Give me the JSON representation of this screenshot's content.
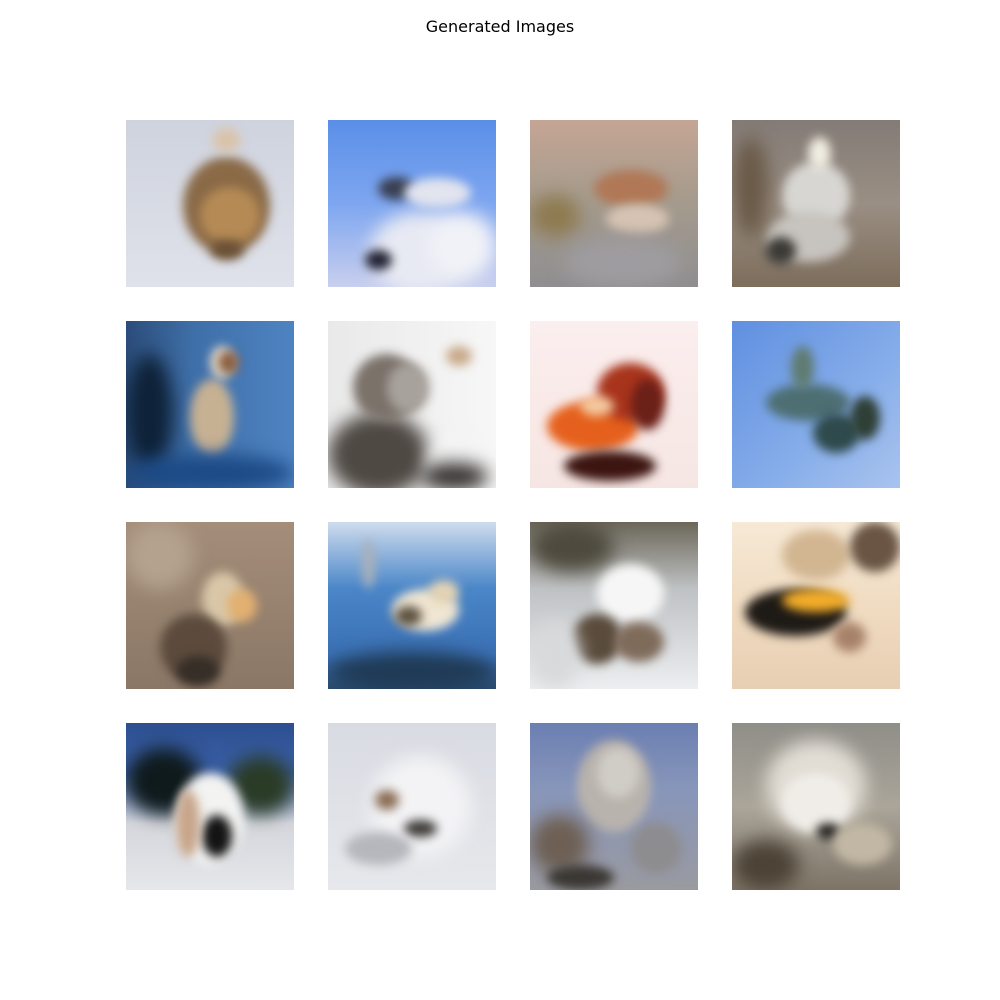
{
  "figure": {
    "title": "Generated Images"
  },
  "images": [
    {
      "bg": "linear-gradient(180deg,#cfd3de 0%,#dfe2ea 100%)",
      "blobs": [
        [
          "#8a6a47",
          34,
          22,
          52,
          58,
          1
        ],
        [
          "#b58a55",
          44,
          40,
          36,
          34,
          1
        ],
        [
          "#d9c3a8",
          52,
          5,
          16,
          14,
          1
        ],
        [
          "#6b5035",
          50,
          72,
          20,
          12,
          1
        ]
      ]
    },
    {
      "bg": "linear-gradient(180deg,#5a8fe8 0%,#7ea6f0 50%,#c9cfee 100%)",
      "blobs": [
        [
          "#e8eaf3",
          25,
          55,
          60,
          50,
          0
        ],
        [
          "#3a3f52",
          30,
          34,
          22,
          14,
          1
        ],
        [
          "#e2e4ee",
          45,
          35,
          40,
          18,
          1
        ],
        [
          "#222233",
          22,
          78,
          16,
          12,
          1
        ],
        [
          "#f1f2f7",
          60,
          55,
          40,
          40,
          0
        ]
      ]
    },
    {
      "bg": "linear-gradient(180deg,#c5a595 0%,#a79c8d 45%,#8f8e90 100%)",
      "blobs": [
        [
          "#b07856",
          38,
          30,
          44,
          22,
          1
        ],
        [
          "#8e7a4f",
          0,
          45,
          30,
          25,
          0
        ],
        [
          "#d6c3b3",
          45,
          50,
          38,
          18,
          1
        ],
        [
          "#9e9c9f",
          20,
          70,
          70,
          30,
          0
        ]
      ]
    },
    {
      "bg": "linear-gradient(180deg,#837b76 0%,#9a8f84 50%,#7d6d5b 100%)",
      "blobs": [
        [
          "#d7d6d2",
          30,
          25,
          40,
          40,
          1
        ],
        [
          "#f0ede2",
          45,
          10,
          14,
          20,
          1
        ],
        [
          "#c7c3be",
          20,
          55,
          50,
          30,
          1
        ],
        [
          "#6a5a48",
          0,
          10,
          22,
          60,
          0
        ],
        [
          "#3b3a36",
          20,
          70,
          18,
          16,
          1
        ]
      ]
    },
    {
      "bg": "linear-gradient(90deg,#2b4c7a 0%,#3f6fa8 40%,#4e83c2 100%)",
      "blobs": [
        [
          "#0e2238",
          0,
          20,
          28,
          70,
          0
        ],
        [
          "#c7b193",
          38,
          35,
          26,
          45,
          1
        ],
        [
          "#e6dccd",
          50,
          15,
          14,
          20,
          1
        ],
        [
          "#8a5d3d",
          55,
          18,
          12,
          14,
          1
        ],
        [
          "#1c4a86",
          0,
          80,
          100,
          22,
          0
        ]
      ]
    },
    {
      "bg": "linear-gradient(90deg,#e9e9e9 0%,#f7f7f7 100%)",
      "blobs": [
        [
          "#4f4944",
          0,
          55,
          60,
          50,
          0
        ],
        [
          "#7b726a",
          15,
          20,
          40,
          40,
          1
        ],
        [
          "#a8a29c",
          35,
          25,
          26,
          30,
          1
        ],
        [
          "#c8aa8a",
          70,
          15,
          16,
          12,
          1
        ],
        [
          "#f4f4f4",
          60,
          70,
          30,
          30,
          0
        ],
        [
          "#2f2c2a",
          55,
          85,
          40,
          16,
          0
        ]
      ]
    },
    {
      "bg": "linear-gradient(180deg,#fbeeee 0%,#f6e6e3 100%)",
      "blobs": [
        [
          "#e5601c",
          10,
          48,
          55,
          30,
          1
        ],
        [
          "#a8341b",
          40,
          25,
          40,
          35,
          1
        ],
        [
          "#3c1410",
          20,
          78,
          55,
          18,
          1
        ],
        [
          "#6b2018",
          60,
          35,
          20,
          30,
          1
        ],
        [
          "#f4c9a0",
          30,
          45,
          20,
          12,
          1
        ]
      ]
    },
    {
      "bg": "linear-gradient(135deg,#5f8fe0 0%,#87aeea 60%,#a9c3ee 100%)",
      "blobs": [
        [
          "#4d6f73",
          20,
          38,
          50,
          22,
          1
        ],
        [
          "#2f4a4c",
          48,
          55,
          28,
          24,
          1
        ],
        [
          "#5f7b6f",
          35,
          15,
          14,
          26,
          1
        ],
        [
          "#2e3f35",
          70,
          45,
          18,
          26,
          1
        ]
      ]
    },
    {
      "bg": "linear-gradient(180deg,#a48e7a 0%,#8b7766 100%)",
      "blobs": [
        [
          "#d9c7a8",
          45,
          30,
          25,
          32,
          1
        ],
        [
          "#e2b070",
          60,
          40,
          18,
          20,
          1
        ],
        [
          "#5c4b3d",
          20,
          55,
          40,
          40,
          1
        ],
        [
          "#362e27",
          30,
          80,
          26,
          18,
          1
        ],
        [
          "#b4a28e",
          0,
          0,
          40,
          40,
          0
        ]
      ]
    },
    {
      "bg": "linear-gradient(180deg,#cfdcee 0%,#4a86c8 40%,#3a70b4 80%,#2b4c6e 100%)",
      "blobs": [
        [
          "#f0e6d2",
          38,
          40,
          40,
          25,
          1
        ],
        [
          "#5d5140",
          40,
          50,
          16,
          12,
          1
        ],
        [
          "#e3d3b4",
          60,
          35,
          18,
          14,
          1
        ],
        [
          "#1f3a55",
          0,
          78,
          100,
          24,
          0
        ],
        [
          "#aab1ba",
          20,
          10,
          8,
          30,
          1
        ]
      ]
    },
    {
      "bg": "linear-gradient(180deg,#6b6658 0%,#bfc2c4 40%,#eceef0 100%)",
      "blobs": [
        [
          "#4e4a3e",
          0,
          0,
          50,
          30,
          0
        ],
        [
          "#f6f6f6",
          40,
          25,
          40,
          35,
          1
        ],
        [
          "#5a4b3b",
          25,
          55,
          30,
          30,
          1
        ],
        [
          "#7f6b5a",
          50,
          60,
          30,
          24,
          1
        ],
        [
          "#d8d9db",
          0,
          60,
          30,
          40,
          0
        ]
      ]
    },
    {
      "bg": "linear-gradient(180deg,#f6e9d6 0%,#efd9be 60%,#e6cfb3 100%)",
      "blobs": [
        [
          "#1e1a16",
          8,
          40,
          60,
          28,
          1
        ],
        [
          "#f3ad2a",
          30,
          40,
          40,
          14,
          1
        ],
        [
          "#d2b692",
          30,
          5,
          40,
          30,
          1
        ],
        [
          "#6a5544",
          70,
          0,
          30,
          30,
          1
        ],
        [
          "#a7826a",
          60,
          60,
          20,
          18,
          1
        ]
      ]
    },
    {
      "bg": "linear-gradient(180deg,#2d4f90 0%,#3a61a8 30%,#d4d6dc 60%,#e6e7eb 100%)",
      "blobs": [
        [
          "#0f1a1c",
          0,
          15,
          45,
          40,
          0
        ],
        [
          "#2a3b26",
          60,
          20,
          40,
          35,
          0
        ],
        [
          "#f3f3f2",
          30,
          30,
          40,
          55,
          1
        ],
        [
          "#141414",
          45,
          55,
          18,
          25,
          1
        ],
        [
          "#c7a58a",
          30,
          40,
          14,
          40,
          1
        ]
      ]
    },
    {
      "bg": "linear-gradient(180deg,#d9dbe3 0%,#e7e8ec 100%)",
      "blobs": [
        [
          "#f3f3f5",
          25,
          20,
          60,
          60,
          0
        ],
        [
          "#3d3a36",
          45,
          58,
          20,
          10,
          1
        ],
        [
          "#8a6c54",
          28,
          40,
          14,
          12,
          1
        ],
        [
          "#b5b7bd",
          10,
          65,
          40,
          20,
          1
        ]
      ]
    },
    {
      "bg": "linear-gradient(180deg,#6b7fb2 0%,#8896ba 40%,#9a9aa0 100%)",
      "blobs": [
        [
          "#b9b3ad",
          28,
          10,
          44,
          55,
          1
        ],
        [
          "#6d5f53",
          0,
          55,
          35,
          35,
          0
        ],
        [
          "#3b3834",
          10,
          85,
          40,
          15,
          1
        ],
        [
          "#8d8c8e",
          60,
          60,
          30,
          30,
          1
        ],
        [
          "#d0ccc6",
          40,
          15,
          25,
          30,
          1
        ]
      ]
    },
    {
      "bg": "linear-gradient(180deg,#8f8e88 0%,#aba59a 50%,#7d7466 100%)",
      "blobs": [
        [
          "#e2ddd5",
          20,
          10,
          60,
          55,
          0
        ],
        [
          "#f0ede8",
          30,
          30,
          40,
          35,
          1
        ],
        [
          "#4c4236",
          0,
          70,
          40,
          30,
          0
        ],
        [
          "#272420",
          50,
          60,
          14,
          10,
          1
        ],
        [
          "#c2b7a4",
          60,
          60,
          35,
          25,
          1
        ]
      ]
    }
  ]
}
